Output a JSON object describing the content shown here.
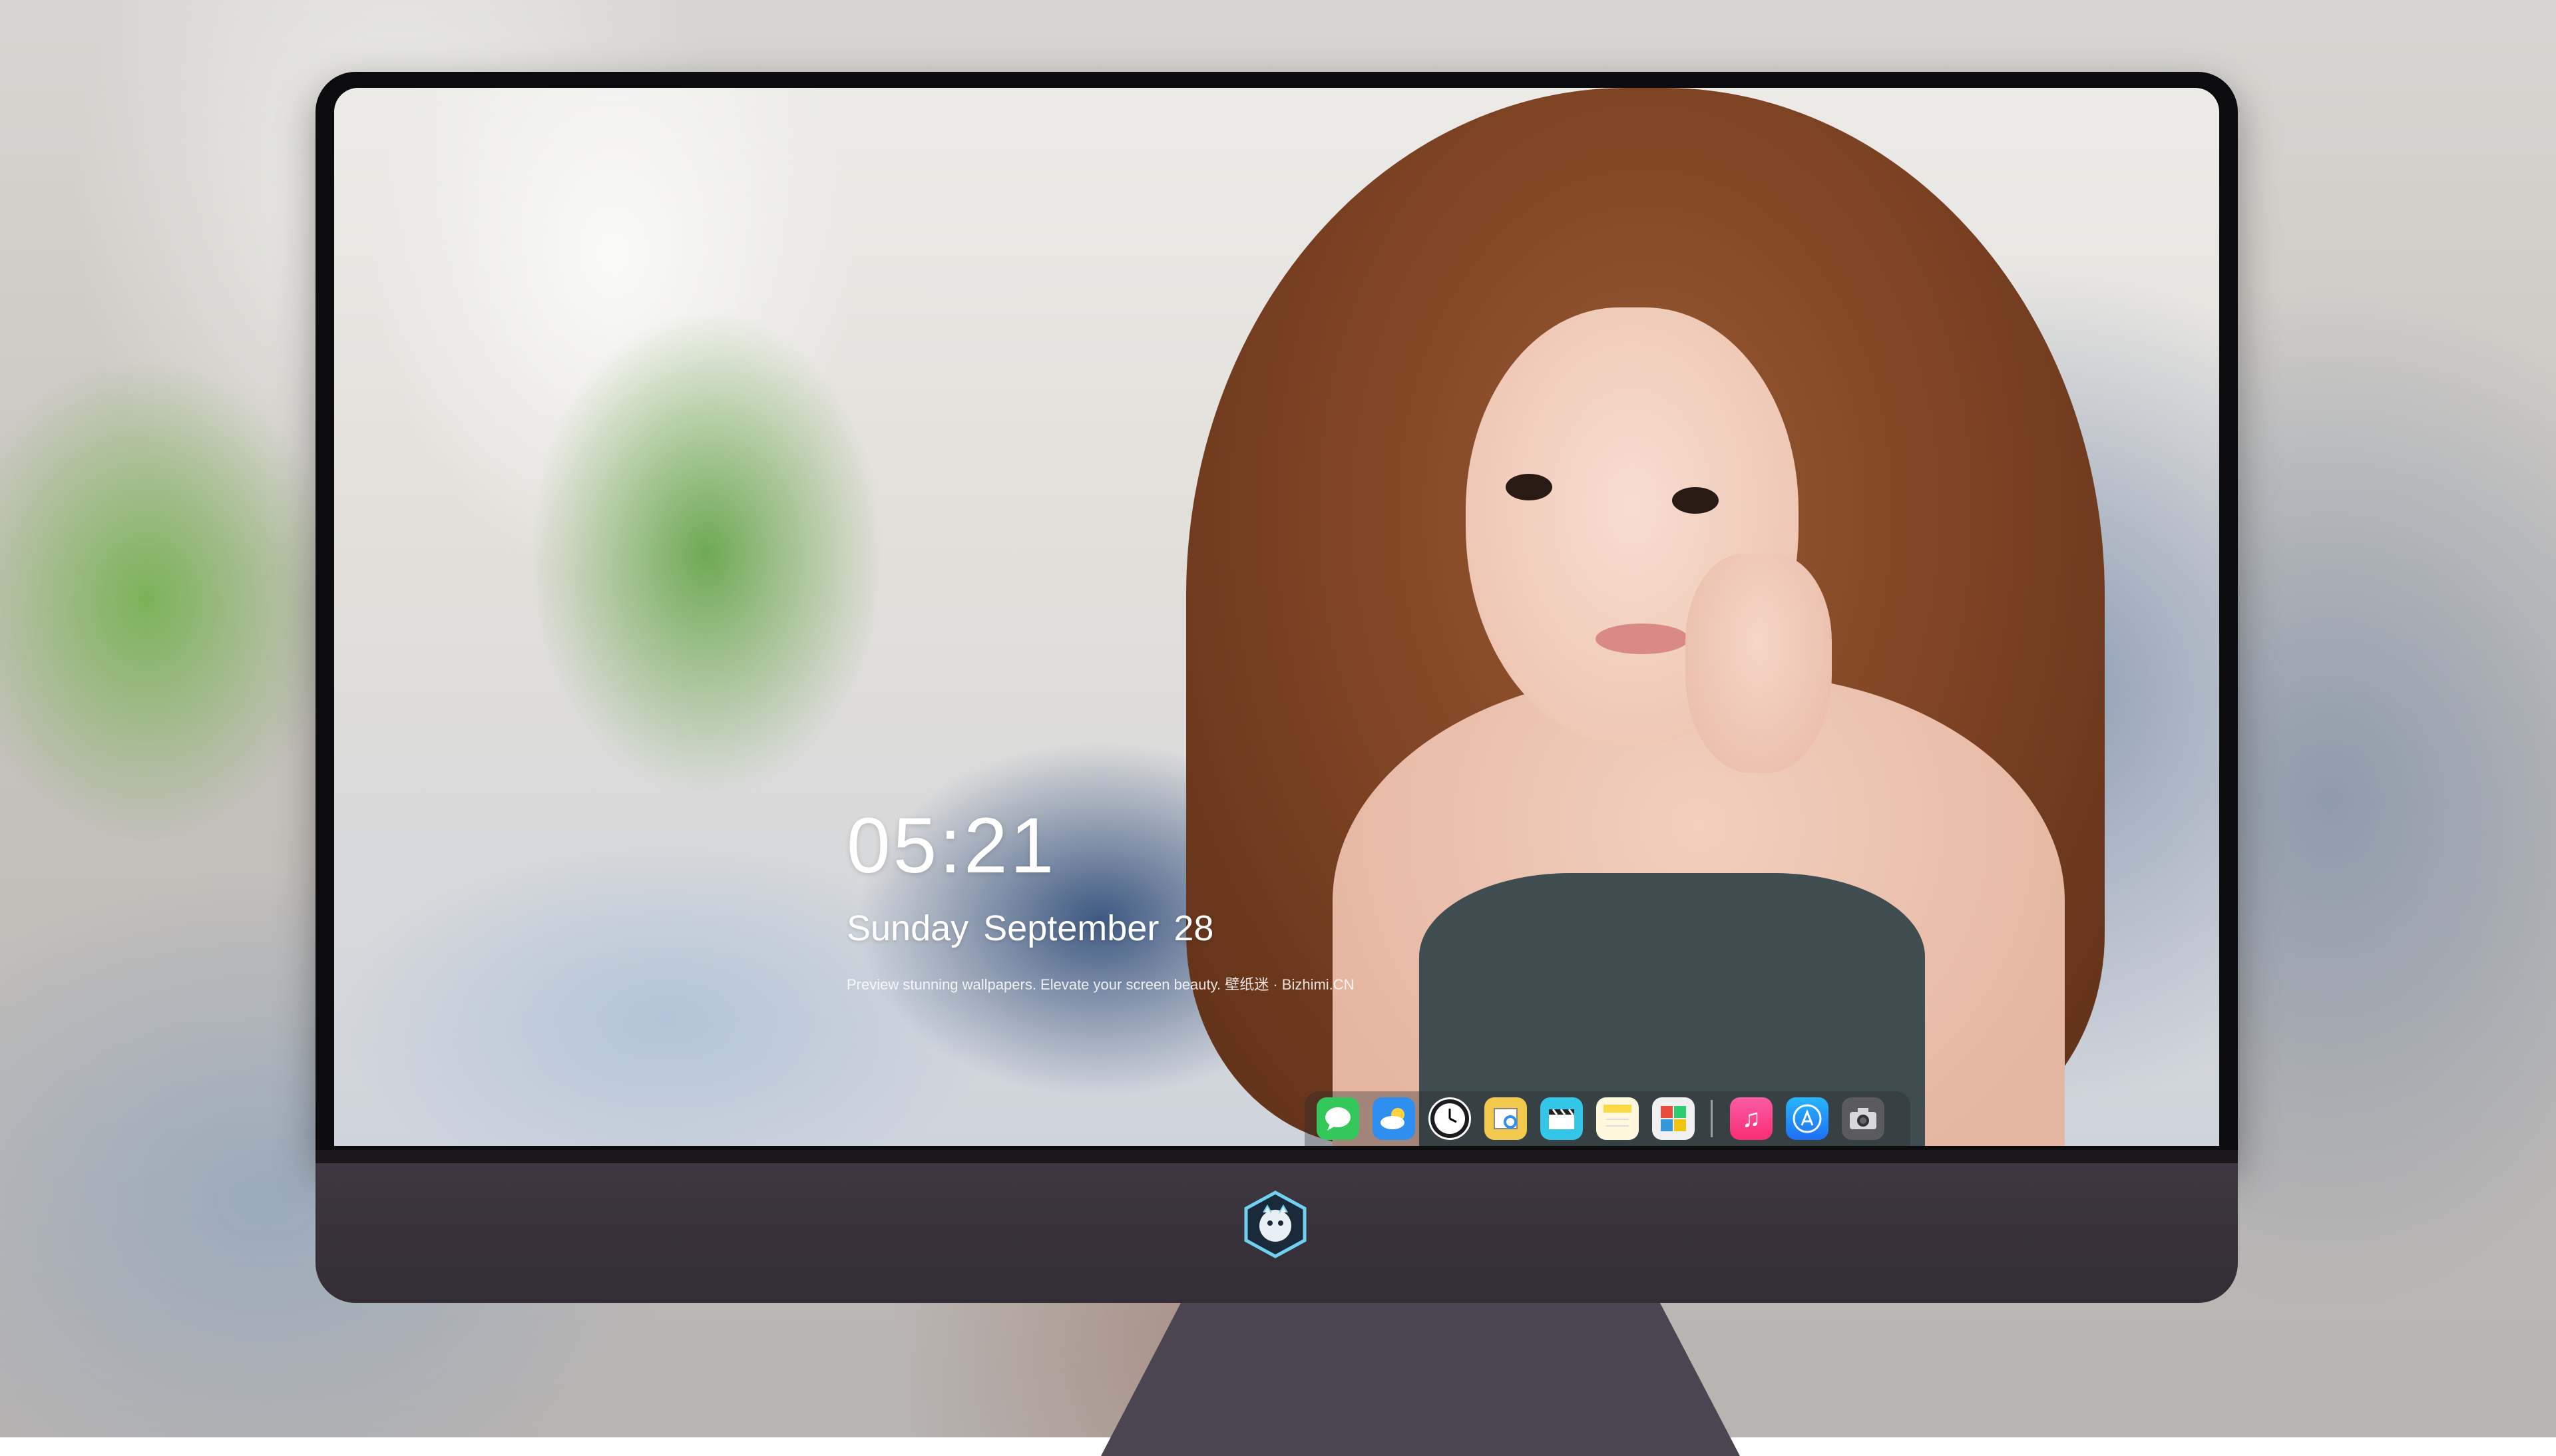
{
  "lock_screen": {
    "time": "05:21",
    "weekday": "Sunday",
    "month": "September",
    "day": "28",
    "tagline": "Preview stunning wallpapers. Elevate your screen beauty. 壁纸迷 · Bizhimi.CN"
  },
  "dock": {
    "apps": [
      {
        "name": "messages-icon",
        "color": "#34c759"
      },
      {
        "name": "weather-icon",
        "color": "#2f8ff0"
      },
      {
        "name": "clock-icon",
        "color": "#1c1c1e"
      },
      {
        "name": "preview-icon",
        "color": "#f2c94c"
      },
      {
        "name": "clips-icon",
        "color": "#33c6e8"
      },
      {
        "name": "notes-icon",
        "color": "#ffd84a"
      },
      {
        "name": "photo-booth-icon",
        "color": "#e74c3c"
      },
      {
        "name": "music-icon",
        "color": "#fa2d73"
      },
      {
        "name": "app-store-icon",
        "color": "#1f8df5"
      },
      {
        "name": "camera-icon",
        "color": "#6e6e73"
      }
    ]
  },
  "monitor": {
    "logo": "bizhimi-logo"
  }
}
